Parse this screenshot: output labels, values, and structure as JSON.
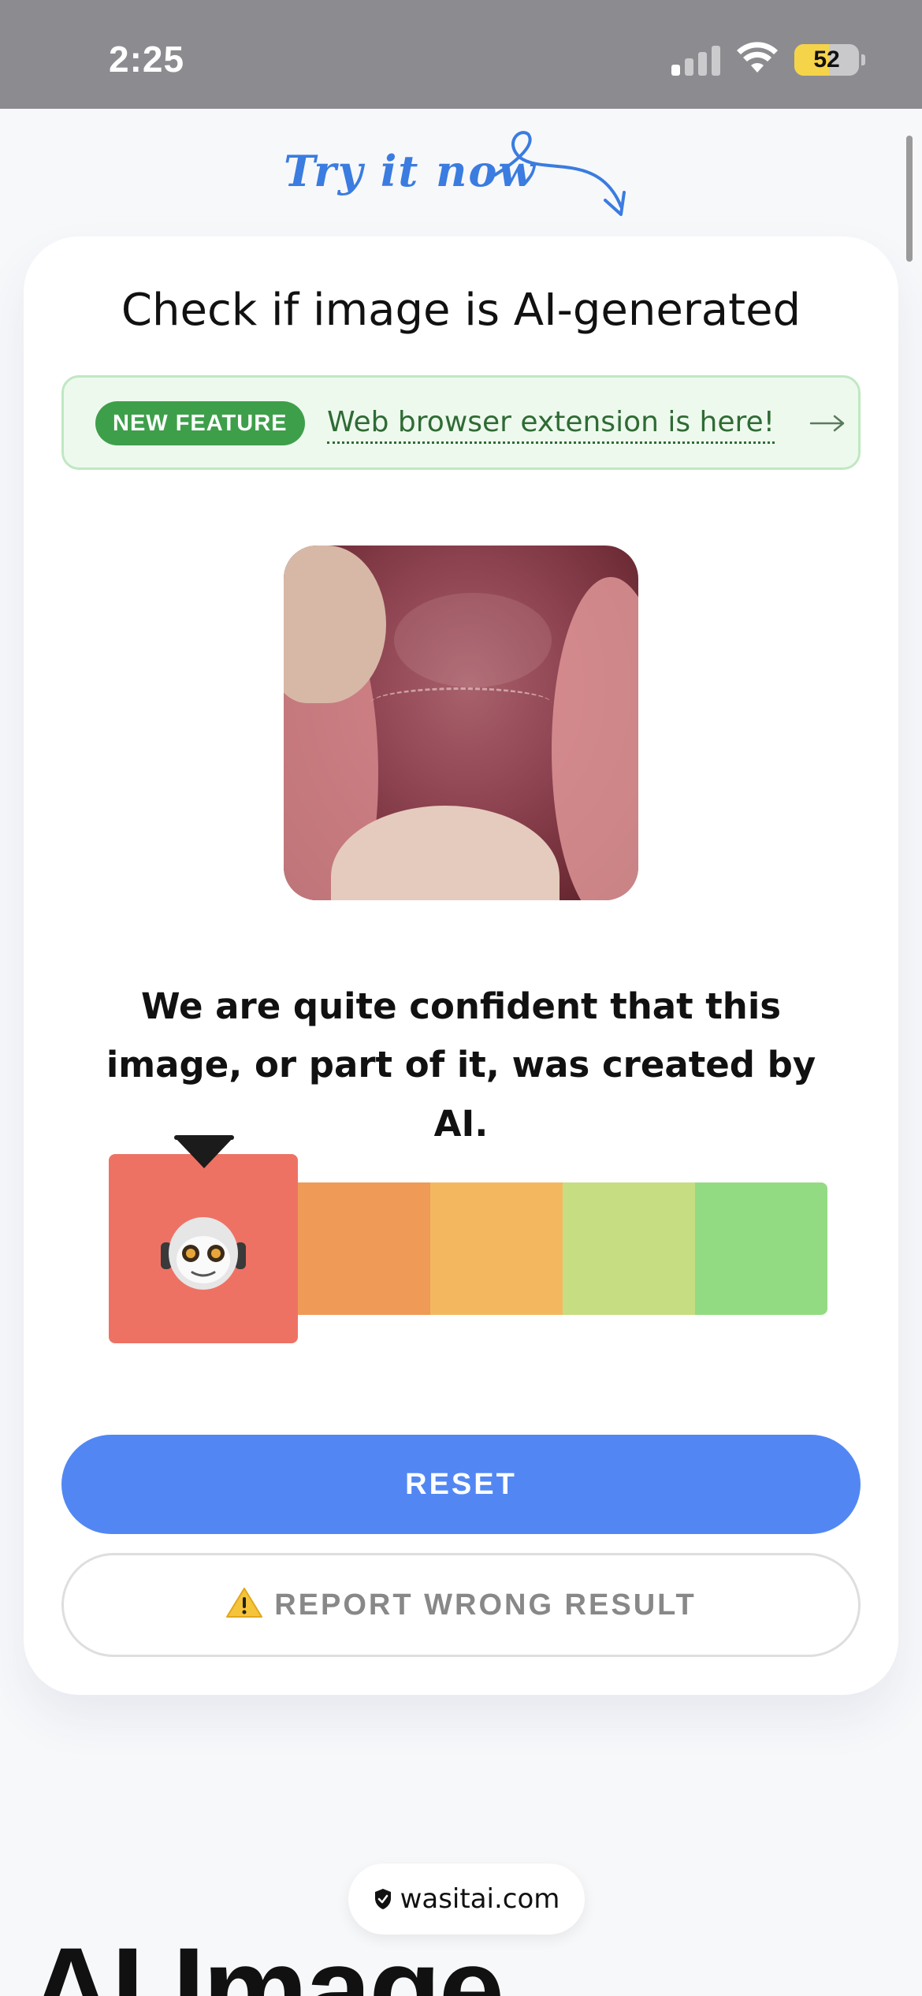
{
  "status_bar": {
    "time": "2:25",
    "battery": "52"
  },
  "hero": {
    "try_label": "Try it now"
  },
  "card": {
    "title": "Check if image is AI-generated",
    "banner": {
      "badge": "NEW FEATURE",
      "link": "Web browser extension is here!",
      "arrow_icon": "arrow-right-icon"
    },
    "verdict": "We are quite confident that this image, or part of it, was created by AI.",
    "meter": {
      "selected_level": 1,
      "levels": 5,
      "colors": [
        "#ee7264",
        "#ef9a57",
        "#f3b85f",
        "#c7dd82",
        "#93db82"
      ],
      "selected_icon": "robot-icon"
    },
    "reset_button": "RESET",
    "report_button": "REPORT WRONG RESULT"
  },
  "footer": {
    "url": "wasitai.com",
    "heading": "AI Image"
  },
  "colors": {
    "primary": "#5287f3",
    "badge_green": "#3e9f4a"
  }
}
